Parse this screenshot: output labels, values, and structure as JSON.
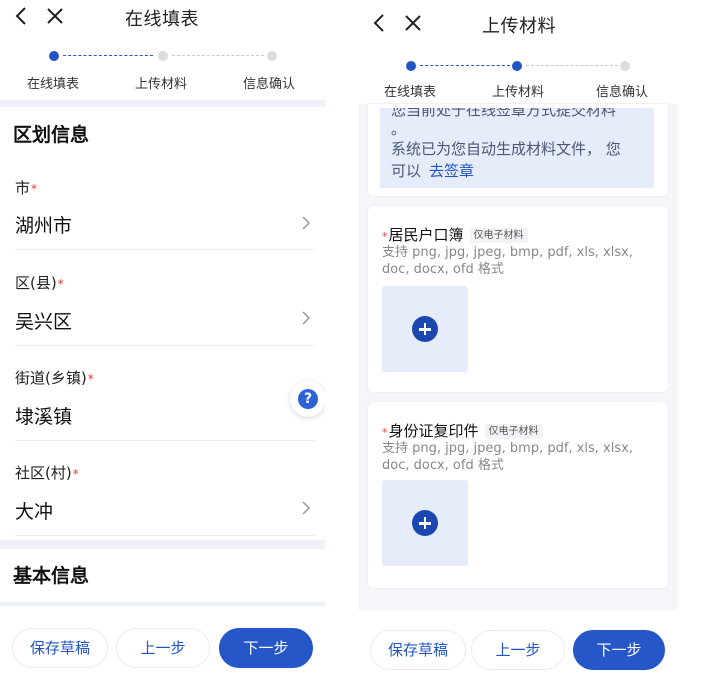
{
  "steps": [
    "在线填表",
    "上传材料",
    "信息确认"
  ],
  "left": {
    "title": "在线填表",
    "section_region": "区划信息",
    "section_basic": "基本信息",
    "fields": [
      {
        "label": "市",
        "value": "湖州市",
        "required": "*"
      },
      {
        "label": "区(县)",
        "value": "吴兴区",
        "required": "*"
      },
      {
        "label": "街道(乡镇)",
        "value": "埭溪镇",
        "required": "*"
      },
      {
        "label": "社区(村)",
        "value": "大冲",
        "required": "*"
      }
    ],
    "help_label": "?"
  },
  "right": {
    "title": "上传材料",
    "notice": {
      "line1": "您当前处于在线签章方式提交材料",
      "line2": "。",
      "line3": "系统已为您自动生成材料文件， 您",
      "line4": "可以",
      "link": "去签章"
    },
    "materials": [
      {
        "required": "*",
        "name": "居民户口簿",
        "tag": "仅电子材料",
        "desc": "支持 png, jpg, jpeg, bmp, pdf, xls, xlsx, doc, docx, ofd 格式"
      },
      {
        "required": "*",
        "name": "身份证复印件",
        "tag": "仅电子材料",
        "desc": "支持 png, jpg, jpeg, bmp, pdf, xls, xlsx, doc, docx, ofd 格式"
      }
    ]
  },
  "buttons": {
    "save": "保存草稿",
    "prev": "上一步",
    "next": "下一步"
  },
  "colors": {
    "primary": "#2557c9",
    "required": "#e53935",
    "band": "#eef2f8",
    "notice_bg": "#e6ecfa"
  }
}
